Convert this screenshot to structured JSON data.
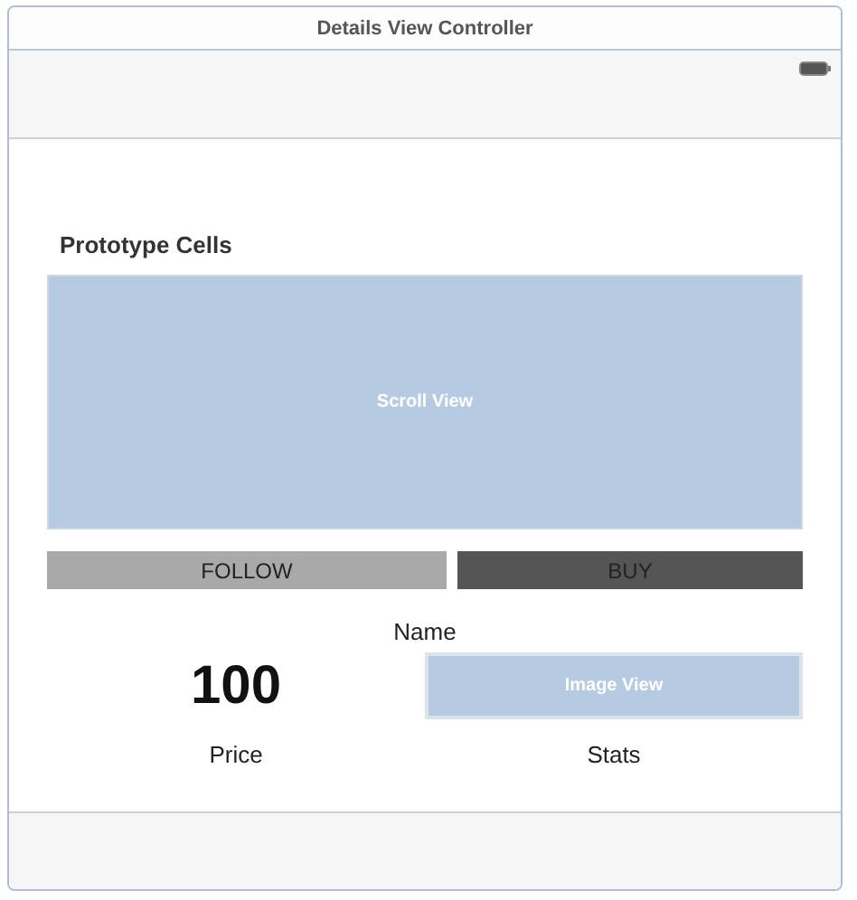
{
  "scene": {
    "title": "Details View Controller"
  },
  "section_header": "Prototype Cells",
  "scroll_view": {
    "label": "Scroll View"
  },
  "buttons": [
    {
      "label": "FOLLOW",
      "kind": "light"
    },
    {
      "label": "BUY",
      "kind": "dark"
    }
  ],
  "name_label": "Name",
  "price_value": "100",
  "image_view": {
    "label": "Image View"
  },
  "price_label": "Price",
  "stats_label": "Stats"
}
